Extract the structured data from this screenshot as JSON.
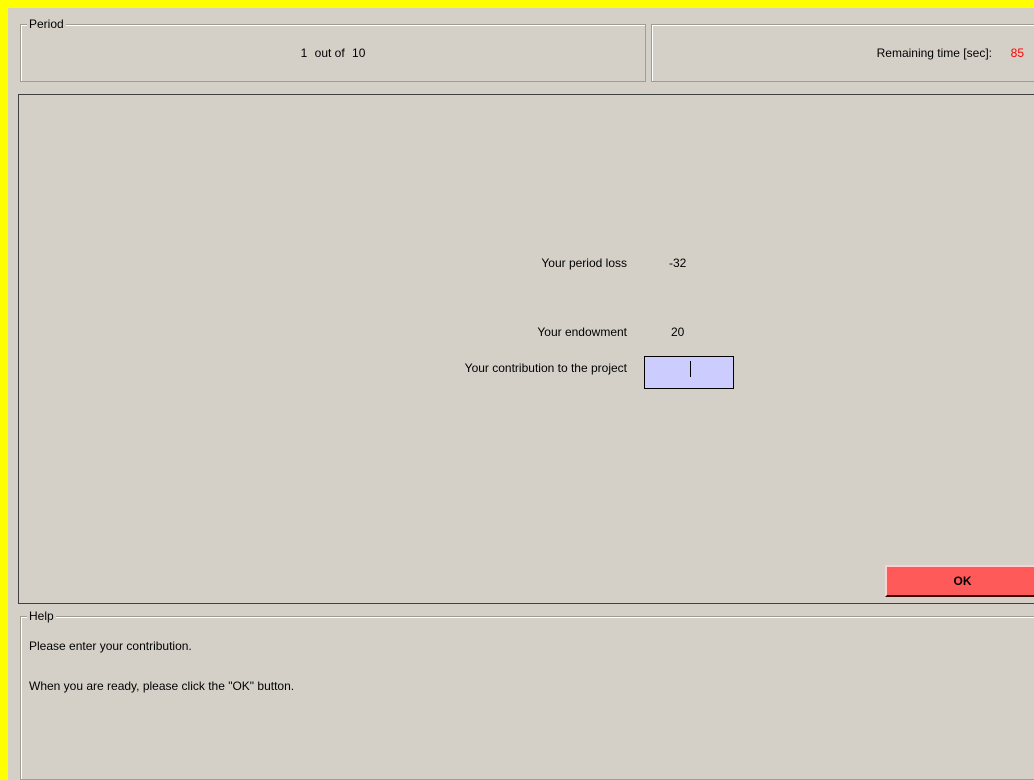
{
  "period": {
    "title": "Period",
    "current": "1",
    "out_of_label": "out of",
    "total": "10"
  },
  "timer": {
    "label": "Remaining time [sec]:",
    "value": "85",
    "value_color": "#ff0000"
  },
  "main": {
    "loss_label": "Your period loss",
    "loss_value": "-32",
    "endowment_label": "Your endowment",
    "endowment_value": "20",
    "contribution_label": "Your contribution to the project",
    "contribution_value": "",
    "input_bg_color": "#ccccff",
    "ok_label": "OK",
    "ok_color": "#ff5a5a"
  },
  "help": {
    "title": "Help",
    "line1": "Please enter your contribution.",
    "line2": "When you are ready, please click the \"OK\" button."
  },
  "colors": {
    "border": "#ffff00",
    "panel": "#d4d0c8"
  }
}
